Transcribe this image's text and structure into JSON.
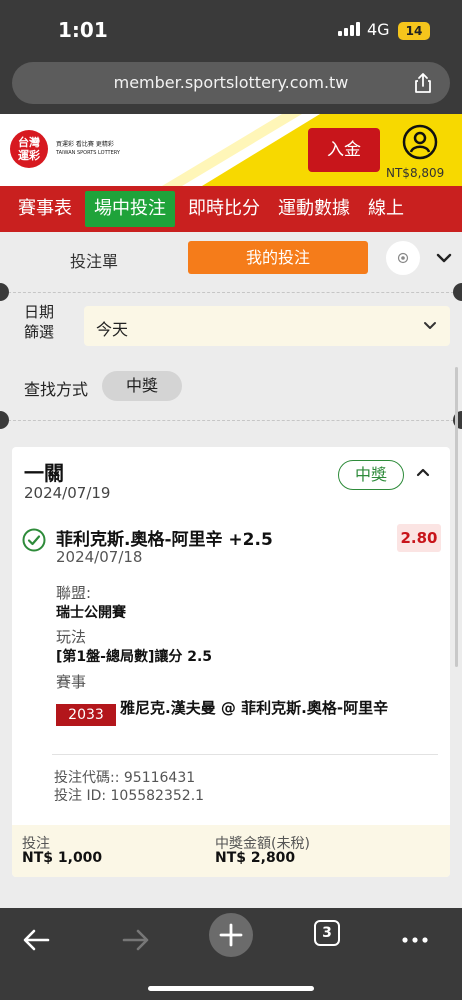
{
  "status_bar": {
    "time": "1:01",
    "network": "4G",
    "battery": "14"
  },
  "browser": {
    "url": "member.sportslottery.com.tw",
    "tab_count": "3"
  },
  "site_header": {
    "logo_text": "台灣\n運彩",
    "logo_tagline_1": "買運彩 看比賽 更精彩",
    "logo_tagline_2": "TAIWAN SPORTS LOTTERY",
    "deposit_label": "入金",
    "balance": "NT$8,809"
  },
  "nav": {
    "items": [
      {
        "label": "賽事表"
      },
      {
        "label": "場中投注"
      },
      {
        "label": "即時比分"
      },
      {
        "label": "運動數據"
      },
      {
        "label": "線上"
      }
    ]
  },
  "betslip": {
    "tab_slip": "投注單",
    "tab_mine": "我的投注",
    "date_filter_label": "日期\n篩選",
    "date_filter_value": "今天",
    "find_label": "查找方式",
    "find_chip": "中獎"
  },
  "bet": {
    "type": "一關",
    "date": "2024/07/19",
    "status": "中獎",
    "selection": "菲利克斯.奧格-阿里辛 +2.5",
    "selection_date": "2024/07/18",
    "odds": "2.80",
    "league_label": "聯盟:",
    "league": "瑞士公開賽",
    "market_label": "玩法",
    "market": "[第1盤-總局數]讓分 2.5",
    "event_label": "賽事",
    "event_code": "2033",
    "event_name": "雅尼克.漢夫曼 @ 菲利克斯.奧格-阿里辛",
    "bet_code": "投注代碼:: 95116431",
    "bet_id": "投注 ID: 105582352.1",
    "stake_label": "投注",
    "stake": "NT$ 1,000",
    "payout_label": "中獎金額(未稅)",
    "payout": "NT$ 2,800"
  },
  "colors": {
    "brand_red": "#c9201f",
    "active_green": "#1fa33a",
    "tab_orange": "#f57c1a",
    "win_green": "#2e8b3a",
    "header_yellow": "#f7d900"
  }
}
